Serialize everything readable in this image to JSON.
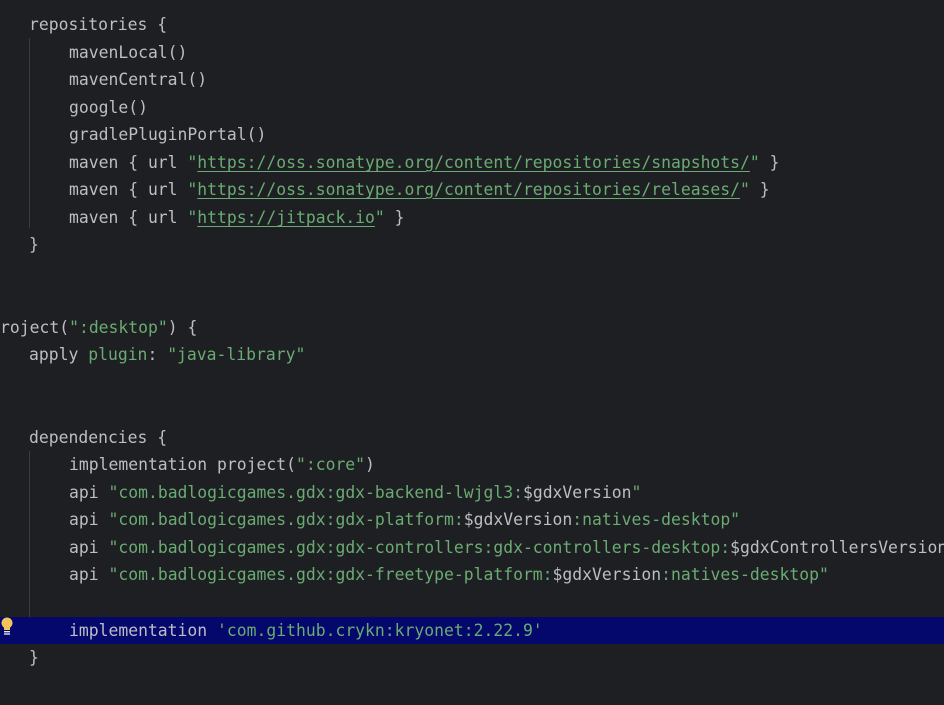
{
  "editor": {
    "lines": [
      {
        "id": "l1",
        "segments": [
          {
            "t": "repositories {",
            "c": "n"
          }
        ]
      },
      {
        "id": "l2",
        "segments": [
          {
            "t": "mavenLocal()",
            "c": "n"
          }
        ]
      },
      {
        "id": "l3",
        "segments": [
          {
            "t": "mavenCentral()",
            "c": "n"
          }
        ]
      },
      {
        "id": "l4",
        "segments": [
          {
            "t": "google()",
            "c": "n"
          }
        ]
      },
      {
        "id": "l5",
        "segments": [
          {
            "t": "gradlePluginPortal()",
            "c": "n"
          }
        ]
      },
      {
        "id": "l6",
        "segments": [
          {
            "t": "maven { url ",
            "c": "n"
          },
          {
            "t": "\"",
            "c": "s"
          },
          {
            "t": "https://oss.sonatype.org/content/repositories/snapshots/",
            "c": "url"
          },
          {
            "t": "\"",
            "c": "s"
          },
          {
            "t": " }",
            "c": "n"
          }
        ]
      },
      {
        "id": "l7",
        "segments": [
          {
            "t": "maven { url ",
            "c": "n"
          },
          {
            "t": "\"",
            "c": "s"
          },
          {
            "t": "https://oss.sonatype.org/content/repositories/releases/",
            "c": "url"
          },
          {
            "t": "\"",
            "c": "s"
          },
          {
            "t": " }",
            "c": "n"
          }
        ]
      },
      {
        "id": "l8",
        "segments": [
          {
            "t": "maven { url ",
            "c": "n"
          },
          {
            "t": "\"",
            "c": "s"
          },
          {
            "t": "https://jitpack.io",
            "c": "url"
          },
          {
            "t": "\"",
            "c": "s"
          },
          {
            "t": " }",
            "c": "n"
          }
        ]
      },
      {
        "id": "l9",
        "segments": [
          {
            "t": "}",
            "c": "n"
          }
        ]
      },
      {
        "id": "l10",
        "segments": []
      },
      {
        "id": "l11",
        "segments": []
      },
      {
        "id": "l12",
        "segments": [
          {
            "t": "roject(",
            "c": "n"
          },
          {
            "t": "\":desktop\"",
            "c": "s"
          },
          {
            "t": ") {",
            "c": "n"
          }
        ]
      },
      {
        "id": "l13",
        "segments": [
          {
            "t": "apply ",
            "c": "n"
          },
          {
            "t": "plugin",
            "c": "kw"
          },
          {
            "t": ": ",
            "c": "n"
          },
          {
            "t": "\"java-library\"",
            "c": "s"
          }
        ]
      },
      {
        "id": "l14",
        "segments": []
      },
      {
        "id": "l15",
        "segments": []
      },
      {
        "id": "l16",
        "segments": [
          {
            "t": "dependencies {",
            "c": "n"
          }
        ]
      },
      {
        "id": "l17",
        "segments": [
          {
            "t": "implementation project(",
            "c": "n"
          },
          {
            "t": "\":core\"",
            "c": "s"
          },
          {
            "t": ")",
            "c": "n"
          }
        ]
      },
      {
        "id": "l18",
        "segments": [
          {
            "t": "api ",
            "c": "n"
          },
          {
            "t": "\"com.badlogicgames.gdx:gdx-backend-lwjgl3:",
            "c": "s"
          },
          {
            "t": "$gdxVersion",
            "c": "n"
          },
          {
            "t": "\"",
            "c": "s"
          }
        ]
      },
      {
        "id": "l19",
        "segments": [
          {
            "t": "api ",
            "c": "n"
          },
          {
            "t": "\"com.badlogicgames.gdx:gdx-platform:",
            "c": "s"
          },
          {
            "t": "$gdxVersion",
            "c": "n"
          },
          {
            "t": ":natives-desktop\"",
            "c": "s"
          }
        ]
      },
      {
        "id": "l20",
        "segments": [
          {
            "t": "api ",
            "c": "n"
          },
          {
            "t": "\"com.badlogicgames.gdx:gdx-controllers:gdx-controllers-desktop:",
            "c": "s"
          },
          {
            "t": "$gdxControllersVersion",
            "c": "n"
          },
          {
            "t": "\"",
            "c": "s"
          }
        ]
      },
      {
        "id": "l21",
        "segments": [
          {
            "t": "api ",
            "c": "n"
          },
          {
            "t": "\"com.badlogicgames.gdx:gdx-freetype-platform:",
            "c": "s"
          },
          {
            "t": "$gdxVersion",
            "c": "n"
          },
          {
            "t": ":natives-desktop\"",
            "c": "s"
          }
        ]
      },
      {
        "id": "l22",
        "segments": []
      },
      {
        "id": "l23",
        "segments": [
          {
            "t": "implementation ",
            "c": "n"
          },
          {
            "t": "'com.github.crykn:kryonet:2.22.9'",
            "c": "s"
          }
        ]
      },
      {
        "id": "l24",
        "segments": [
          {
            "t": "}",
            "c": "n"
          }
        ]
      }
    ]
  },
  "gutter": {
    "intention_icon": "lightbulb-icon"
  },
  "colors": {
    "background": "#1e1f22",
    "text": "#bcbec4",
    "string": "#6aab73",
    "highlight": "#04076b",
    "guide": "#393b40",
    "bulb": "#f2c55c"
  }
}
